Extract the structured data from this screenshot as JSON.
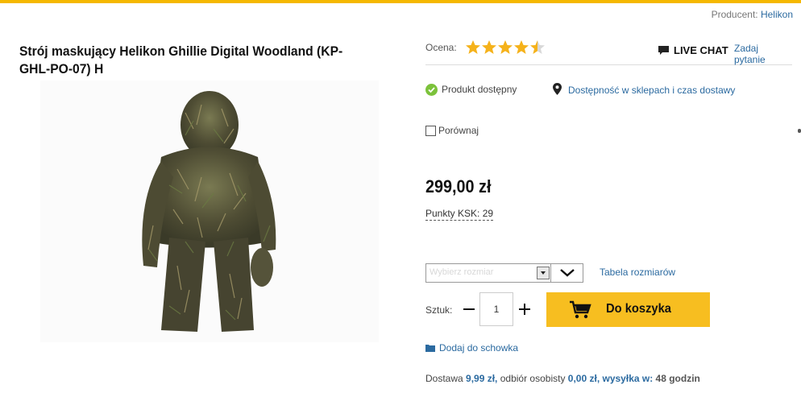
{
  "header": {
    "producer_label": "Producent:",
    "producer_name": "Helikon"
  },
  "product": {
    "title": "Strój maskujący Helikon Ghillie Digital Woodland (KP-GHL-PO-07) H",
    "image_alt": "ghillie-suit-photo"
  },
  "rating": {
    "label": "Ocena:",
    "value": 4.5,
    "max": 5,
    "star_color": "#f5b21b"
  },
  "support": {
    "live_chat": "LIVE CHAT",
    "ask_question": "Zadaj pytanie"
  },
  "availability": {
    "status": "Produkt dostępny",
    "store_link": "Dostępność w sklepach i czas dostawy"
  },
  "compare": {
    "label": "Porównaj"
  },
  "price": {
    "value": "299,00 zł",
    "points": "Punkty KSK: 29"
  },
  "size": {
    "placeholder": "Wybierz rozmiar",
    "table_link": "Tabela rozmiarów"
  },
  "quantity": {
    "label": "Sztuk:",
    "value": "1"
  },
  "cart": {
    "label": "Do koszyka",
    "color": "#f7be20"
  },
  "wishlist": {
    "label": "Dodaj do schowka"
  },
  "delivery": {
    "part1": "Dostawa",
    "part1_value": "9,99 zł,",
    "part2": "odbiór osobisty",
    "part2_value": "0,00 zł,",
    "part3": "wysyłka w:",
    "part3_value": "48 godzin"
  },
  "colors": {
    "accent": "#f5b800",
    "link": "#2b6aa0",
    "ok": "#7cc23b"
  }
}
